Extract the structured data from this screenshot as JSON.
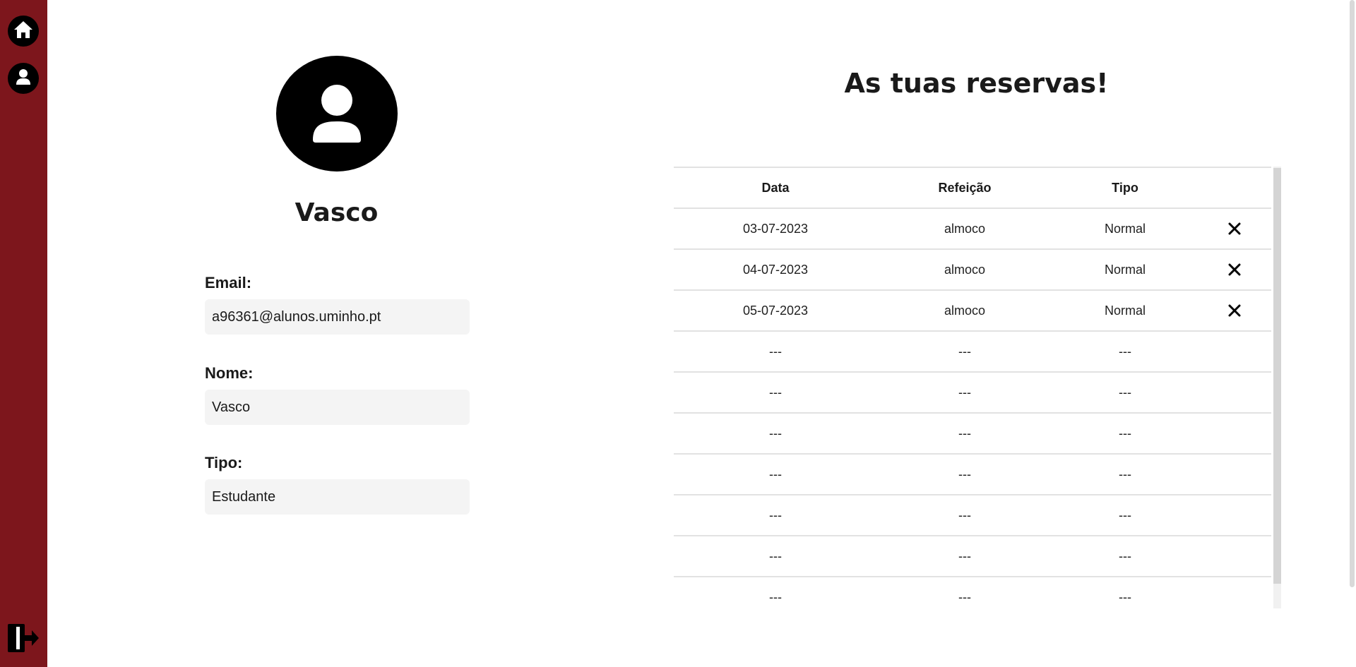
{
  "sidebar": {
    "items": [
      {
        "name": "home",
        "icon": "home-icon"
      },
      {
        "name": "profile",
        "icon": "user-icon"
      }
    ],
    "logout_icon": "logout-icon",
    "background": "#7d161c"
  },
  "profile": {
    "avatar_icon": "user-avatar-icon",
    "name": "Vasco",
    "fields": {
      "email_label": "Email:",
      "email_value": "a96361@alunos.uminho.pt",
      "nome_label": "Nome:",
      "nome_value": "Vasco",
      "tipo_label": "Tipo:",
      "tipo_value": "Estudante"
    }
  },
  "reservations": {
    "title": "As tuas reservas!",
    "columns": [
      "Data",
      "Refeição",
      "Tipo"
    ],
    "rows": [
      [
        "03-07-2023",
        "almoco",
        "Normal"
      ],
      [
        "04-07-2023",
        "almoco",
        "Normal"
      ],
      [
        "05-07-2023",
        "almoco",
        "Normal"
      ],
      [
        "---",
        "---",
        "---"
      ],
      [
        "---",
        "---",
        "---"
      ],
      [
        "---",
        "---",
        "---"
      ],
      [
        "---",
        "---",
        "---"
      ],
      [
        "---",
        "---",
        "---"
      ],
      [
        "---",
        "---",
        "---"
      ],
      [
        "---",
        "---",
        "---"
      ]
    ],
    "delete_icon": "close-icon"
  }
}
